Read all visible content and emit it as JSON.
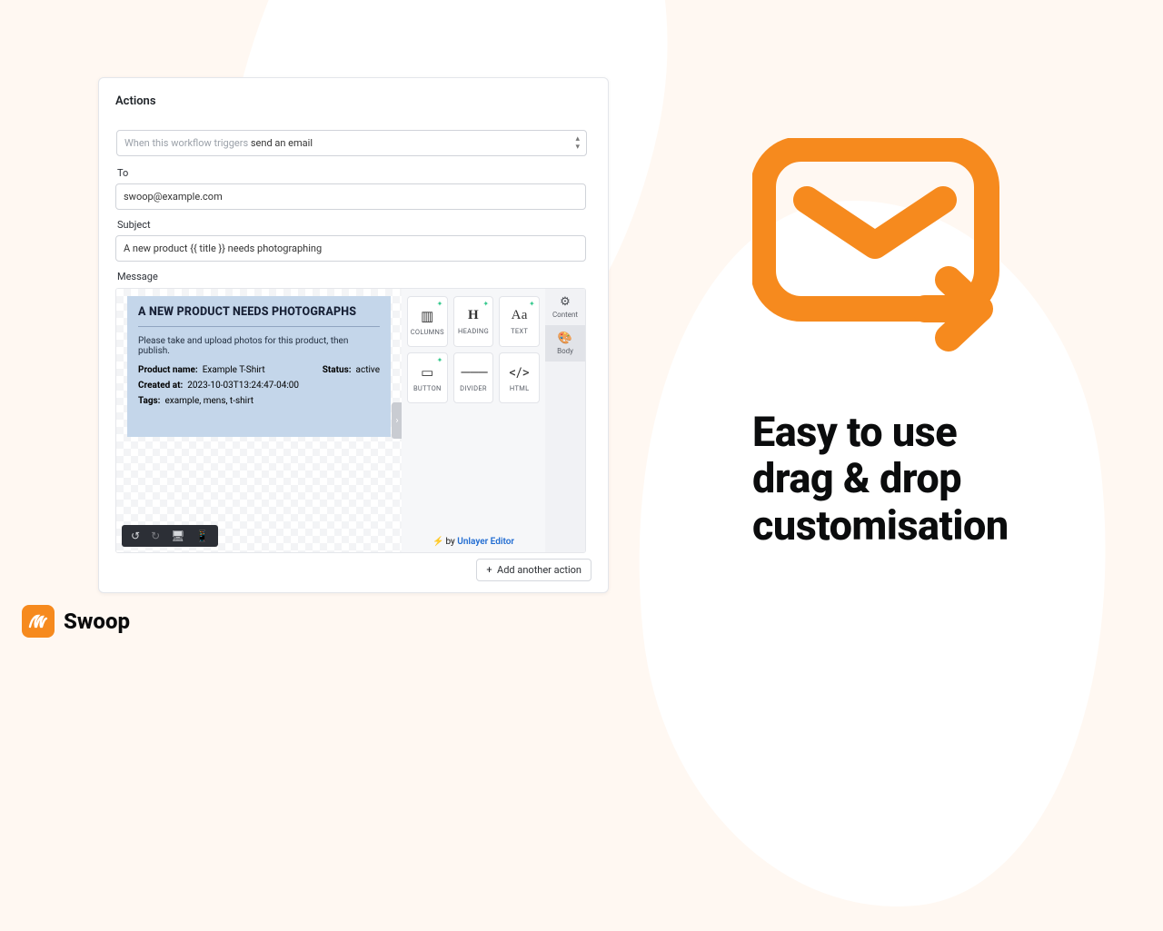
{
  "panel": {
    "title": "Actions",
    "trigger_prefix": "When this workflow triggers ",
    "trigger_action": "send an email",
    "labels": {
      "to": "To",
      "subject": "Subject",
      "message": "Message"
    },
    "to_value": "swoop@example.com",
    "subject_value": "A new product {{ title }} needs photographing",
    "add_button": "Add another action"
  },
  "email_doc": {
    "heading": "A NEW PRODUCT NEEDS PHOTOGRAPHS",
    "instruction": "Please take and upload photos for this product, then publish.",
    "product_name_label": "Product name:",
    "product_name_value": "Example T-Shirt",
    "status_label": "Status:",
    "status_value": "active",
    "created_label": "Created at:",
    "created_value": "2023-10-03T13:24:47-04:00",
    "tags_label": "Tags:",
    "tags_value": "example, mens, t-shirt"
  },
  "blocks": {
    "columns": "COLUMNS",
    "heading": "HEADING",
    "text": "TEXT",
    "button": "BUTTON",
    "divider": "DIVIDER",
    "html": "HTML"
  },
  "rail": {
    "content": "Content",
    "body": "Body"
  },
  "credit": {
    "by": "by",
    "name": "Unlayer Editor"
  },
  "marketing": {
    "tagline": "Easy to use\ndrag & drop\ncustomisation",
    "brand": "Swoop"
  }
}
